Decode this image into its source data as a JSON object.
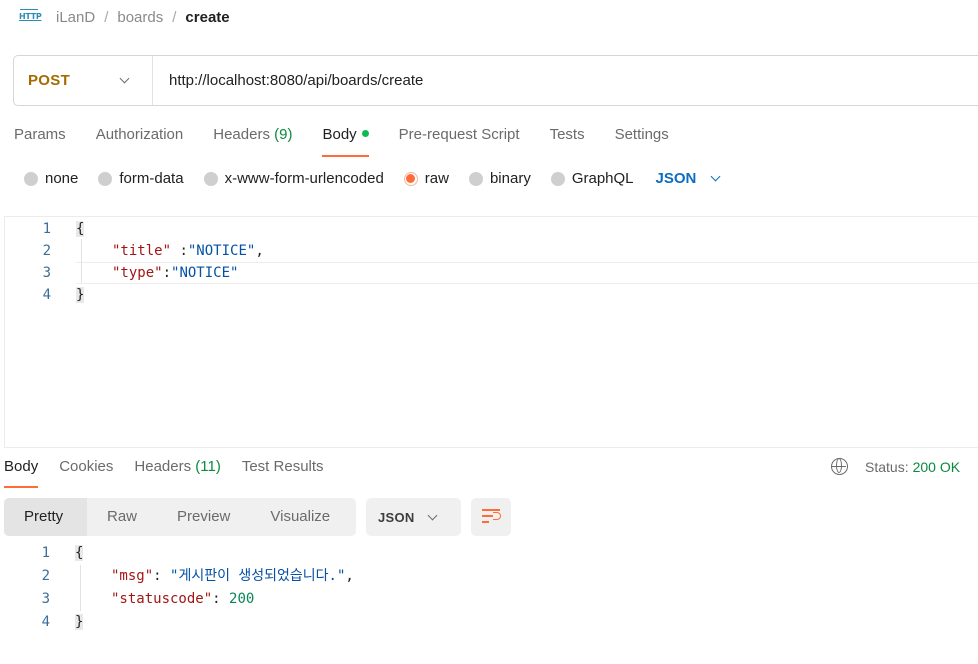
{
  "breadcrumb": {
    "icon": "http-icon",
    "icon_text": "HTTP",
    "workspace": "iLanD",
    "folder": "boards",
    "request": "create",
    "separator": "/"
  },
  "request": {
    "method": "POST",
    "url": "http://localhost:8080/api/boards/create",
    "method_color": "#a56b00"
  },
  "request_tabs": [
    {
      "label": "Params"
    },
    {
      "label": "Authorization"
    },
    {
      "label": "Headers",
      "count": "(9)"
    },
    {
      "label": "Body",
      "active": true
    },
    {
      "label": "Pre-request Script"
    },
    {
      "label": "Tests"
    },
    {
      "label": "Settings"
    }
  ],
  "body_types": {
    "options": [
      "none",
      "form-data",
      "x-www-form-urlencoded",
      "raw",
      "binary",
      "GraphQL"
    ],
    "selected": "raw",
    "format": "JSON"
  },
  "request_body": {
    "line_numbers": [
      "1",
      "2",
      "3",
      "4"
    ],
    "open_brace": "{",
    "close_brace": "}",
    "line2_key": "\"title\"",
    "line2_sep": " :",
    "line2_value": "\"NOTICE\"",
    "line2_comma": ",",
    "line3_key": "\"type\"",
    "line3_sep": ":",
    "line3_value": "\"NOTICE\""
  },
  "response_tabs": [
    {
      "label": "Body",
      "active": true
    },
    {
      "label": "Cookies"
    },
    {
      "label": "Headers",
      "count": "(11)"
    },
    {
      "label": "Test Results"
    }
  ],
  "response_status": {
    "label": "Status:",
    "value": "200 OK",
    "color": "#0b8a3e"
  },
  "view_modes": {
    "options": [
      "Pretty",
      "Raw",
      "Preview",
      "Visualize"
    ],
    "selected": "Pretty",
    "format": "JSON"
  },
  "response_body": {
    "line_numbers": [
      "1",
      "2",
      "3",
      "4"
    ],
    "open_brace": "{",
    "close_brace": "}",
    "line2_key": "\"msg\"",
    "line2_sep": ": ",
    "line2_value": "\"게시판이 생성되었습니다.\"",
    "line2_comma": ",",
    "line3_key": "\"statuscode\"",
    "line3_sep": ": ",
    "line3_value": "200"
  },
  "colors": {
    "accent": "#ff6c37",
    "link_blue": "#0c6dc2",
    "success_green": "#0b8a3e"
  }
}
